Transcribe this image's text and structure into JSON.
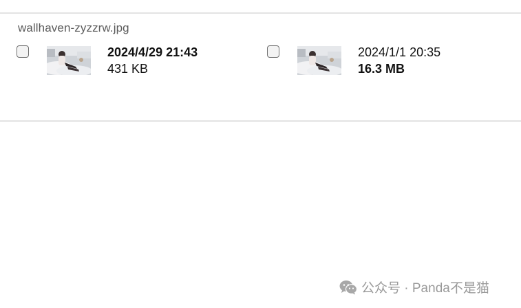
{
  "file_name": "wallhaven-zyzzrw.jpg",
  "files": [
    {
      "date": "2024/4/29 21:43",
      "size": "431 KB",
      "date_bold": true,
      "size_bold": false,
      "checked": false
    },
    {
      "date": "2024/1/1 20:35",
      "size": "16.3 MB",
      "date_bold": false,
      "size_bold": true,
      "checked": false
    }
  ],
  "watermark": {
    "icon": "wechat-icon",
    "text": "公众号 · Panda不是猫"
  }
}
